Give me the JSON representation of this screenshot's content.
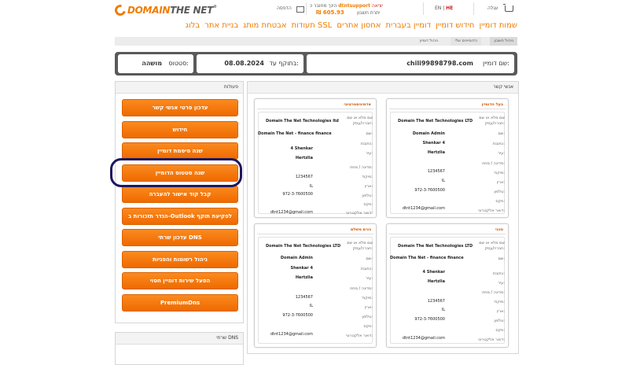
{
  "header": {
    "logo_text_orange": "DOMAIN",
    "logo_text_gray": "THE NET",
    "logo_reg": "®",
    "lang_en": "EN",
    "lang_he": "HE",
    "cart": "עגלה",
    "print": "הדפסה",
    "user_prefix": "הינך מחובר כ",
    "username": "dtntsupport",
    "logout": "יציאה",
    "balance_label": "יתרת חשבון",
    "balance_value": "₪ 605.93"
  },
  "nav": {
    "items": [
      "שמות דומיין",
      "חידוש דומיין",
      "דומיין בעברית",
      "אחסון אתרים",
      "תעודות SSL",
      "אבטחת מותג",
      "בניית אתר",
      "בלוג"
    ]
  },
  "breadcrumb": [
    "ניהול חשבון",
    "הדומיינים שלי",
    "ניהול דומיין"
  ],
  "status": {
    "domain_label": "שם דומיין:",
    "domain_value": "chili99898798.com",
    "valid_label": "בתוקף עד:",
    "valid_value": "08.08.2024",
    "status_label": "סטטוס:",
    "status_value": "מושהה"
  },
  "actions": {
    "title": "פעולות",
    "buttons": [
      "עדכון פרטי אנשי קשר",
      "חידוש",
      "שנה סיסמת דומיין",
      "שנה סטטוס הדומיין",
      "קבל קוד אישור להעברה",
      "הגדר תזכורות ב-Outlook לפקיעת תוקף",
      "עדכון שרתי DNS",
      "ניהול רשומות והפניות",
      "הפעל שירות דומיין חסוי",
      "PremiumDns"
    ]
  },
  "dns_panel": {
    "title": "שרתי DNS"
  },
  "contacts": {
    "title": "אנשי קשר",
    "labels": {
      "org": "שם מלא או שם",
      "org2": "חברה/עסק:",
      "name": "שם:",
      "address": "כתובת:",
      "city": "עיר:",
      "state": "מדינה / מחוז:",
      "zip": "מיקוד:",
      "country": "ארץ:",
      "phone": "טלפון:",
      "fax": "פקס:",
      "email": "דואר אלקטרוני:"
    },
    "cards": [
      {
        "title": "בעל הדומיין",
        "org": "Domain The Net Technologies LTD",
        "name": "Domain Admin",
        "address": "Shenkar 4",
        "city": "Hertzlia",
        "state": "",
        "zip": "1234567",
        "country": "IL",
        "phone": "972-3-7600500",
        "fax": "",
        "email": "dtnt1234@gmail.com"
      },
      {
        "title": "אדמיניסטרטיבי",
        "org": "Domain The Net Technologies ltd",
        "name": "Domain The Net - finance finance",
        "address": "4 Shenkar",
        "city": "Hertzlia",
        "state": "",
        "zip": "1234567",
        "country": "IL",
        "phone": "972-3-7600500",
        "fax": "",
        "email": "dtnt1234@gmail.com"
      },
      {
        "title": "טכני",
        "org": "Domain The Net Technologies LTD",
        "name": "Domain The Net - finance finance",
        "address": "4 Shenkar",
        "city": "Hertzlia",
        "state": "",
        "zip": "1234567",
        "country": "IL",
        "phone": "972-3-7600500",
        "fax": "",
        "email": "dtnt1234@gmail.com"
      },
      {
        "title": "גורם משלם",
        "org": "Domain The Net Technologies LTD",
        "name": "Domain Admin",
        "address": "Shenkar 4",
        "city": "Hertzlia",
        "state": "",
        "zip": "1234567",
        "country": "IL",
        "phone": "972-3-7600500",
        "fax": "",
        "email": "dtnt1234@gmail.com"
      }
    ]
  },
  "colors": {
    "accent": "#f07c00",
    "status_bar": "#5a5a5a",
    "highlight_ring": "#1c1760"
  }
}
